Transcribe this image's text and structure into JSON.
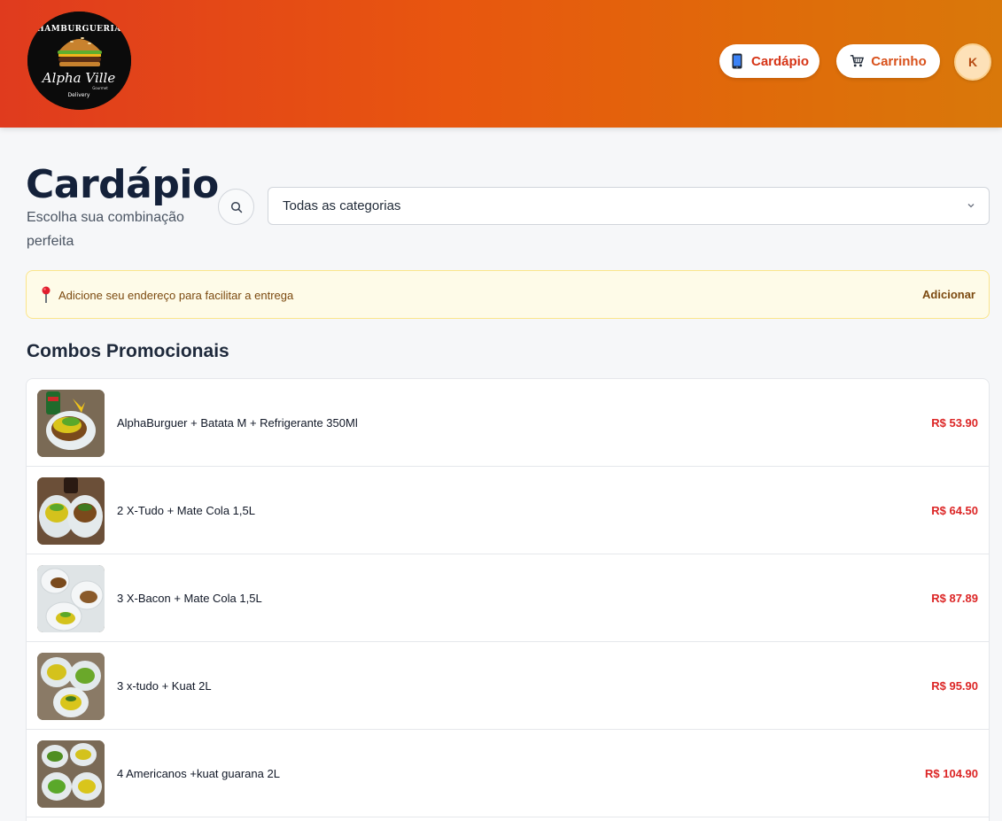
{
  "brand": {
    "logo_text_top": "HAMBURGUERIA",
    "logo_text_script": "Alpha Ville",
    "logo_text_small": "Gourmet",
    "logo_text_bottom": "Delivery"
  },
  "header": {
    "menu_label": "Cardápio",
    "menu_icon": "mobile-phone-icon",
    "cart_label": "Carrinho",
    "cart_icon": "shopping-cart-icon",
    "avatar_initial": "K"
  },
  "page": {
    "title": "Cardápio",
    "subtitle": "Escolha sua combinação perfeita"
  },
  "filters": {
    "search_icon": "search-icon",
    "category_selected": "Todas as categorias"
  },
  "address_banner": {
    "message": "Adicione seu endereço para facilitar a entrega",
    "action": "Adicionar"
  },
  "section": {
    "title": "Combos Promocionais",
    "items": [
      {
        "name": "AlphaBurguer + Batata M + Refrigerante 350Ml",
        "price": "R$ 53.90"
      },
      {
        "name": "2 X-Tudo + Mate Cola 1,5L",
        "price": "R$ 64.50"
      },
      {
        "name": "3 X-Bacon + Mate Cola 1,5L",
        "price": "R$ 87.89"
      },
      {
        "name": "3 x-tudo + Kuat 2L",
        "price": "R$ 95.90"
      },
      {
        "name": "4 Americanos +kuat guarana 2L",
        "price": "R$ 104.90"
      }
    ]
  },
  "colors": {
    "header_start": "#e03b1e",
    "header_end": "#d9780a",
    "price": "#dc2626",
    "banner_bg": "#fefbe8"
  }
}
